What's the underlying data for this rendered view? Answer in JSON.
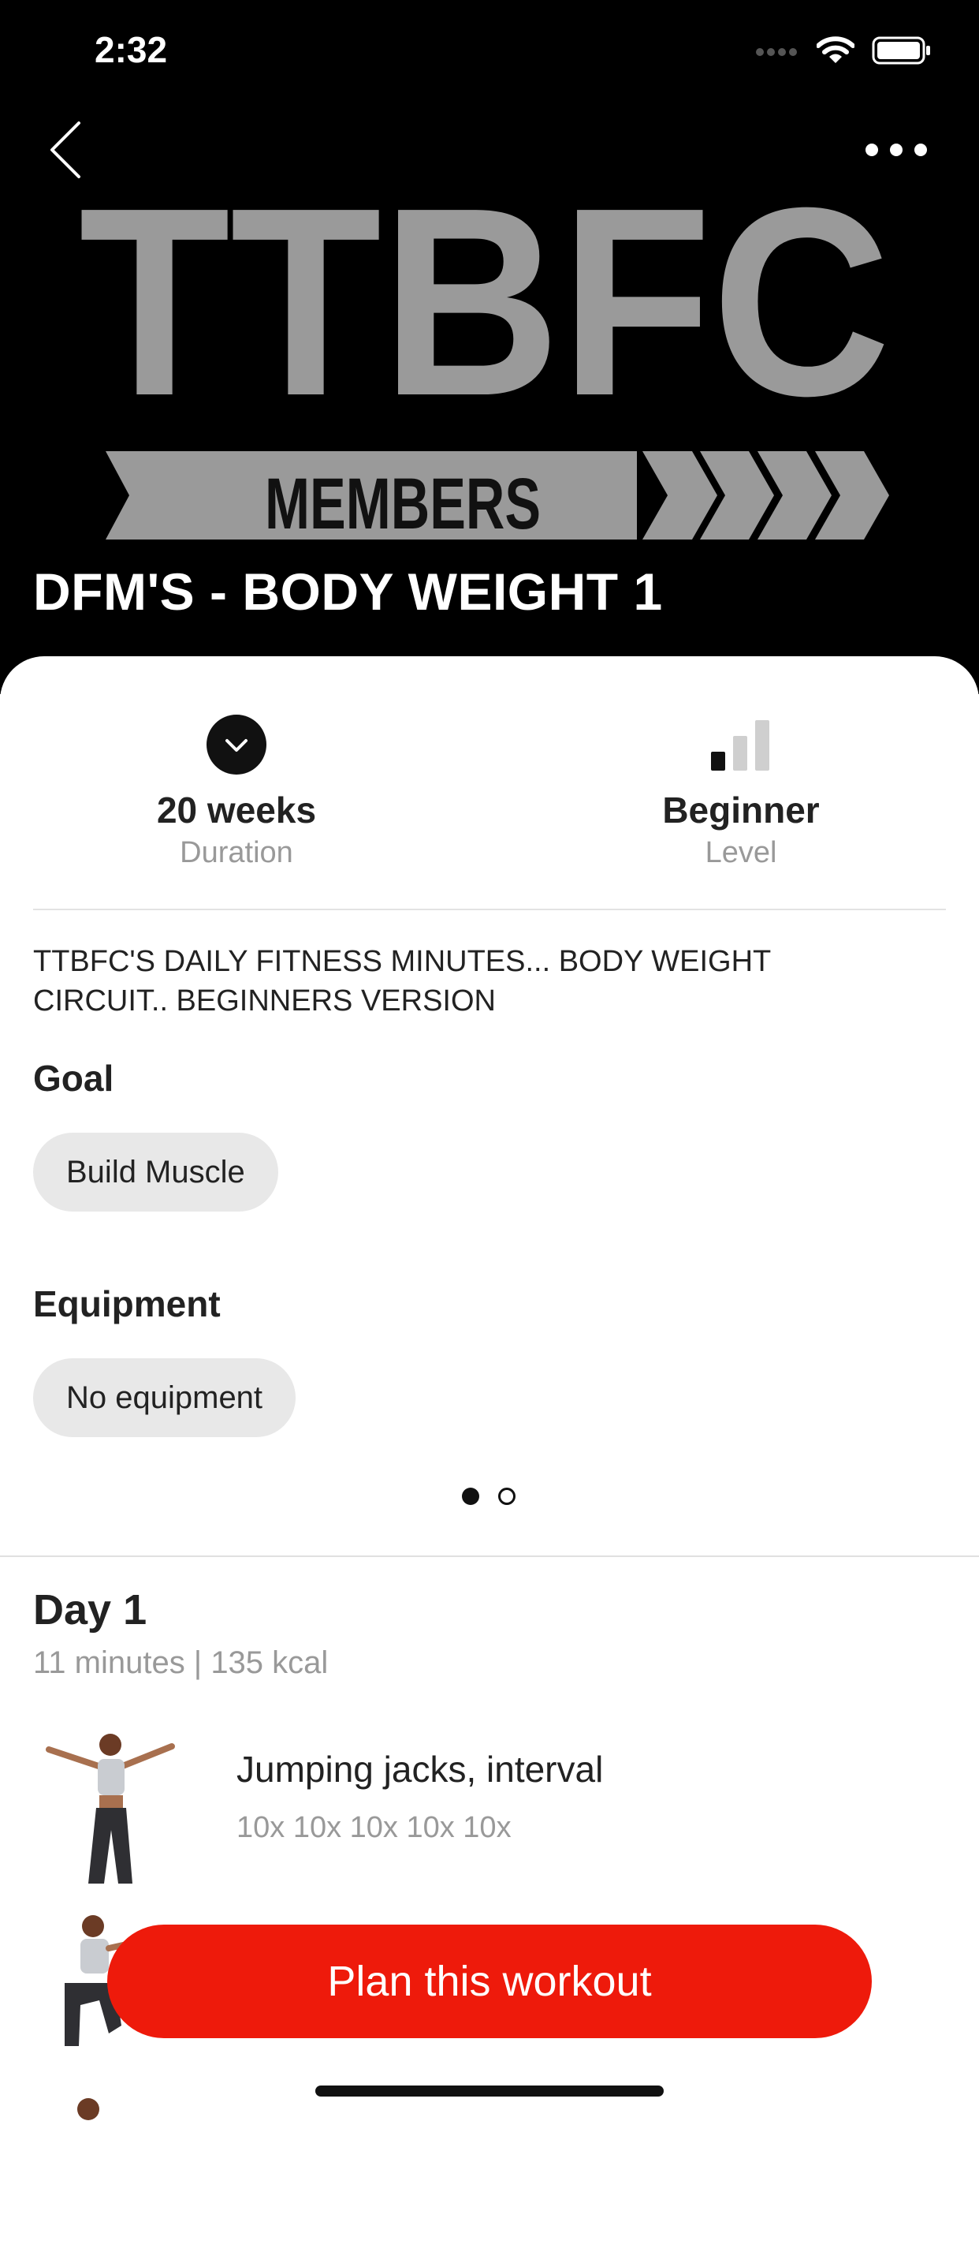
{
  "status_bar": {
    "time": "2:32"
  },
  "hero": {
    "logo_text": "TTBFC",
    "logo_banner": "MEMBERS",
    "title": "DFM'S - BODY WEIGHT 1"
  },
  "stats": {
    "duration": {
      "value": "20 weeks",
      "label": "Duration"
    },
    "level": {
      "value": "Beginner",
      "label": "Level"
    }
  },
  "description_lines": [
    "TTBFC'S DAILY FITNESS MINUTES... BODY WEIGHT",
    "CIRCUIT.. BEGINNERS VERSION"
  ],
  "goal": {
    "title": "Goal",
    "chip": "Build Muscle"
  },
  "equipment": {
    "title": "Equipment",
    "chip": "No equipment"
  },
  "pager": {
    "total": 2,
    "active_index": 0
  },
  "day": {
    "title": "Day 1",
    "subtitle": "11 minutes | 135 kcal",
    "exercises": [
      {
        "name": "Jumping jacks, interval",
        "reps": "10x 10x 10x 10x 10x"
      }
    ]
  },
  "cta": {
    "label": "Plan this workout"
  },
  "colors": {
    "accent": "#ee1a0b",
    "hero_bg": "#000000",
    "logo_gray": "#9a9a9a",
    "chip_bg": "#e8e8e8",
    "muted_text": "#999999"
  },
  "icons": {
    "back": "chevron-left-icon",
    "more": "more-horizontal-icon",
    "duration": "chevron-down-circle-icon",
    "level": "signal-bars-icon"
  }
}
